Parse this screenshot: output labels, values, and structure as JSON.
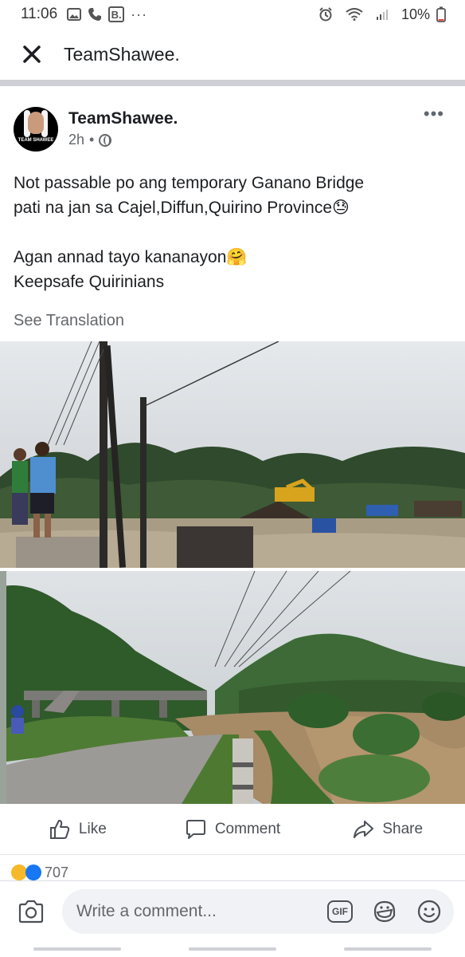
{
  "status_bar": {
    "time": "11:06",
    "battery": "10%",
    "icons": [
      "image-icon",
      "phone-icon",
      "b-app-icon",
      "more-dots-icon",
      "alarm-icon",
      "wifi-icon",
      "signal-icon"
    ]
  },
  "header": {
    "title": "TeamShawee.",
    "close_icon": "close-icon"
  },
  "post": {
    "author": "TeamShawee.",
    "avatar_text": "TEAM SHAWEE",
    "time": "2h",
    "separator": "•",
    "privacy_icon": "globe-icon",
    "more": "•••",
    "text_lines": [
      "Not passable po ang temporary Ganano Bridge",
      "pati na jan sa Cajel,Diffun,Quirino Province😓",
      "",
      "Agan annad tayo kananayon🤗",
      "Keepsafe Quirinians"
    ],
    "see_translation": "See Translation",
    "photos": [
      {
        "name": "flooded-road-photo"
      },
      {
        "name": "flooded-river-bridge-photo"
      }
    ]
  },
  "actions": {
    "like": "Like",
    "comment": "Comment",
    "share": "Share"
  },
  "reactions": {
    "count": "707",
    "types": [
      "sad",
      "like"
    ]
  },
  "comment_bar": {
    "placeholder": "Write a comment...",
    "gif_label": "GIF"
  },
  "colors": {
    "primary_text": "#1c1e21",
    "secondary_text": "#65676b",
    "divider": "#cfd0d6",
    "input_bg": "#f0f2f5",
    "like_blue": "#1877f2",
    "sad_yellow": "#f7b928"
  }
}
